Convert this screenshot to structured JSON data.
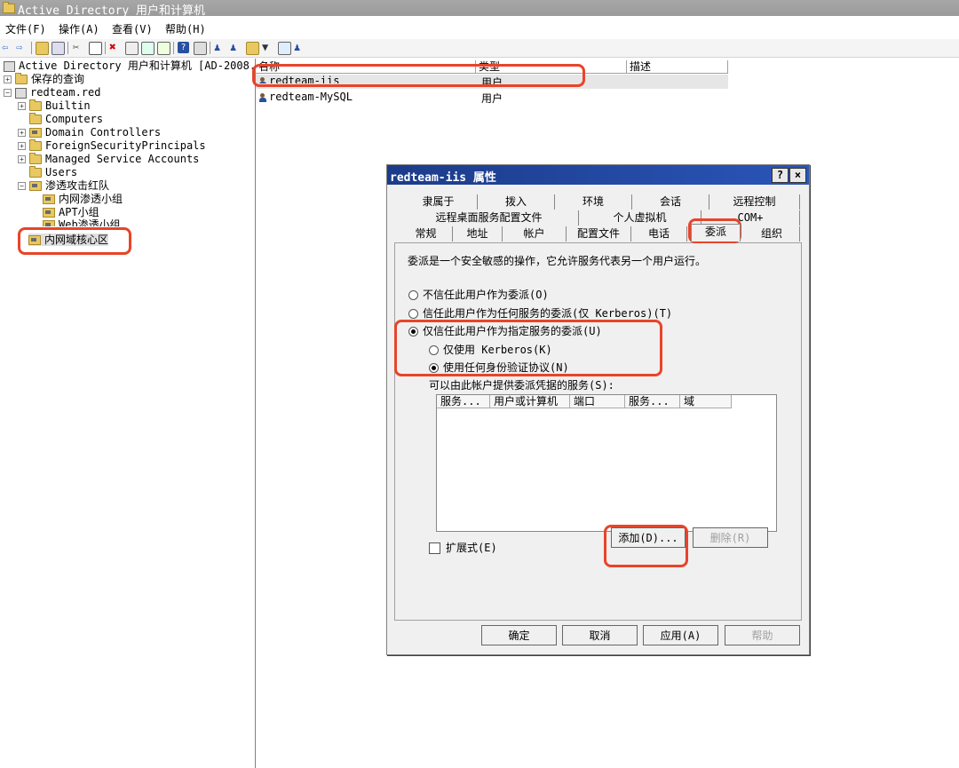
{
  "window": {
    "title": "Active Directory 用户和计算机"
  },
  "menu": [
    "文件(F)",
    "操作(A)",
    "查看(V)",
    "帮助(H)"
  ],
  "tree": {
    "root": "Active Directory 用户和计算机 [AD-2008.",
    "saved_queries": "保存的查询",
    "domain": "redteam.red",
    "builtin": "Builtin",
    "computers": "Computers",
    "domain_controllers": "Domain Controllers",
    "fsp": "ForeignSecurityPrincipals",
    "msa": "Managed Service Accounts",
    "users": "Users",
    "red_team": "渗透攻击红队",
    "intranet_group": "内网渗透小组",
    "apt_group": "APT小组",
    "web_group": "Web渗透小组",
    "core_zone": "内网域核心区"
  },
  "list": {
    "headers": {
      "name": "名称",
      "type": "类型",
      "desc": "描述"
    },
    "rows": [
      {
        "name": "redteam-iis",
        "type": "用户"
      },
      {
        "name": "redteam-MySQL",
        "type": "用户"
      }
    ]
  },
  "dialog": {
    "title": "redteam-iis 属性",
    "help_btn": "?",
    "close_btn": "×",
    "tabs_row1": [
      "隶属于",
      "拨入",
      "环境",
      "会话",
      "远程控制"
    ],
    "tabs_row2": [
      "远程桌面服务配置文件",
      "个人虚拟机",
      "COM+"
    ],
    "tabs_row3": [
      "常规",
      "地址",
      "帐户",
      "配置文件",
      "电话",
      "委派",
      "组织"
    ],
    "description": "委派是一个安全敏感的操作，它允许服务代表另一个用户运行。",
    "options": {
      "no_trust": "不信任此用户作为委派(O)",
      "trust_any": "信任此用户作为任何服务的委派(仅 Kerberos)(T)",
      "trust_specified": "仅信任此用户作为指定服务的委派(U)",
      "kerberos_only": "仅使用 Kerberos(K)",
      "any_protocol": "使用任何身份验证协议(N)"
    },
    "services_label": "可以由此帐户提供委派凭据的服务(S):",
    "services_headers": [
      "服务...",
      "用户或计算机",
      "端口",
      "服务...",
      "域"
    ],
    "expanded": "扩展式(E)",
    "add": "添加(D)...",
    "remove": "删除(R)",
    "ok": "确定",
    "cancel": "取消",
    "apply": "应用(A)",
    "help": "帮助"
  },
  "colors": {
    "highlight": "#e8442a",
    "dialog_title": "#1c3b8a"
  }
}
